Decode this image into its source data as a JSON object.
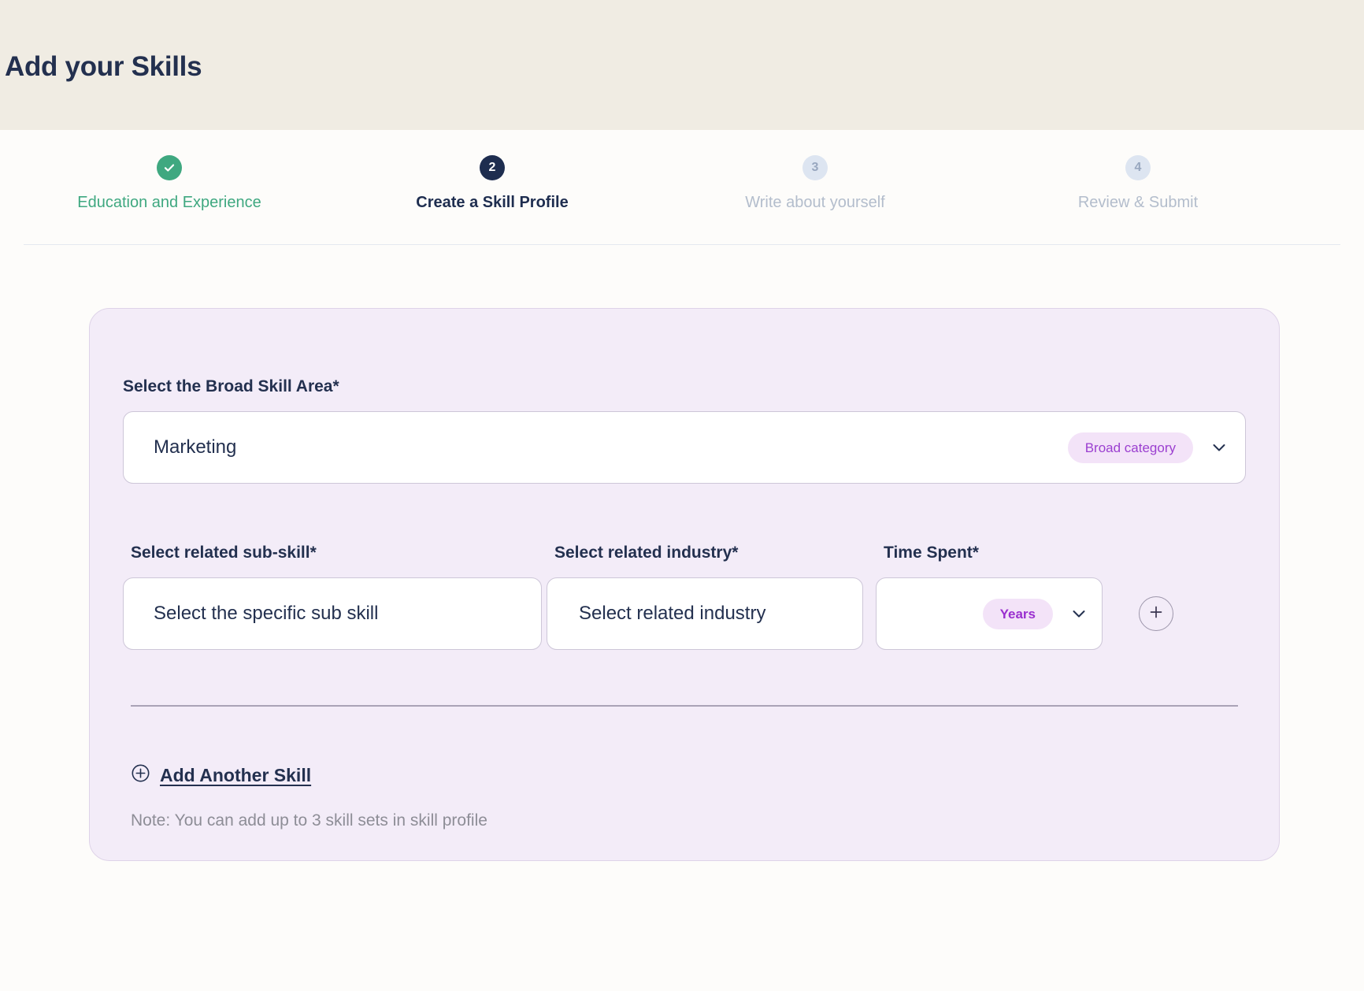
{
  "header": {
    "title": "Add your Skills",
    "background_color": "#f0ece3"
  },
  "stepper": {
    "steps": [
      {
        "number": "1",
        "marker": "check-icon",
        "label": "Education and Experience",
        "state": "completed",
        "color": "#3fa880"
      },
      {
        "number": "2",
        "marker": "2",
        "label": "Create a Skill Profile",
        "state": "active",
        "color": "#1e2d4f"
      },
      {
        "number": "3",
        "marker": "3",
        "label": "Write about yourself",
        "state": "upcoming",
        "color": "#b3bdcc"
      },
      {
        "number": "4",
        "marker": "4",
        "label": "Review & Submit",
        "state": "upcoming",
        "color": "#b3bdcc"
      }
    ]
  },
  "card": {
    "background_color": "#f3ecf8",
    "broad_skill": {
      "label": "Select the Broad Skill Area*",
      "value": "Marketing",
      "badge": "Broad category"
    },
    "sub_skill": {
      "label": "Select related sub-skill*",
      "placeholder": "Select the specific sub skill",
      "value": ""
    },
    "industry": {
      "label": "Select related industry*",
      "placeholder": "Select related industry",
      "value": ""
    },
    "time_spent": {
      "label": "Time Spent*",
      "badge": "Years",
      "value": ""
    },
    "add_row_button": "add-row-icon",
    "add_another": {
      "label": "Add Another Skill",
      "icon": "plus-circle-icon"
    },
    "note": "Note: You can add up to 3 skill sets in skill profile"
  },
  "colors": {
    "navy": "#23304f",
    "green": "#3fa880",
    "purple": "#9b3fd0",
    "pill_bg": "#f3e3f8",
    "card_bg": "#f3ecf8"
  }
}
